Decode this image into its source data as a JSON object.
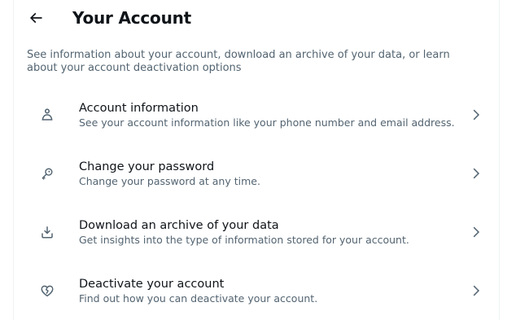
{
  "header": {
    "back_label": "Back",
    "title": "Your Account"
  },
  "description": "See information about your account, download an archive of your data, or learn about your account deactivation options",
  "menu": {
    "items": [
      {
        "icon": "person-icon",
        "label": "Account information",
        "sublabel": "See your account information like your phone number and email address."
      },
      {
        "icon": "key-icon",
        "label": "Change your password",
        "sublabel": "Change your password at any time."
      },
      {
        "icon": "download-icon",
        "label": "Download an archive of your data",
        "sublabel": "Get insights into the type of information stored for your account."
      },
      {
        "icon": "broken-heart-icon",
        "label": "Deactivate your account",
        "sublabel": "Find out how you can deactivate your account."
      }
    ]
  },
  "colors": {
    "text_primary": "#0f1419",
    "text_secondary": "#536471",
    "border": "#eff3f4",
    "background": "#ffffff"
  }
}
